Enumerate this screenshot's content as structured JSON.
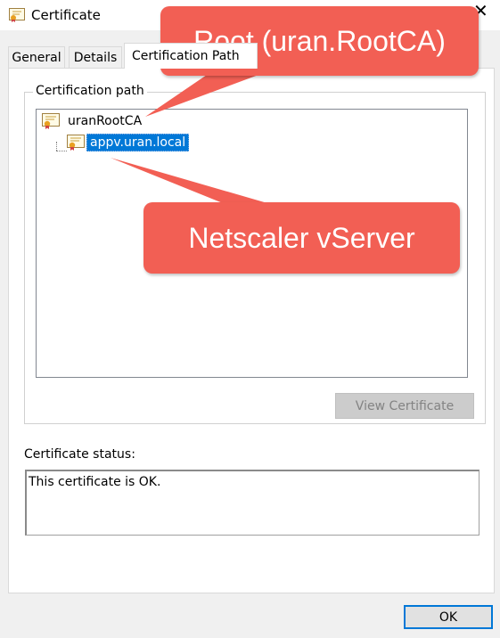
{
  "window": {
    "title": "Certificate",
    "close_glyph": "✕"
  },
  "tabs": [
    {
      "label": "General"
    },
    {
      "label": "Details"
    },
    {
      "label": "Certification Path"
    }
  ],
  "certification_path": {
    "legend": "Certification path",
    "root": {
      "label": "uranRootCA",
      "icon": "certificate-icon"
    },
    "child": {
      "label": "appv.uran.local",
      "icon": "certificate-icon",
      "selected": true
    },
    "view_button": "View Certificate"
  },
  "status": {
    "label": "Certificate status:",
    "text": "This certificate is OK."
  },
  "ok_button": "OK",
  "annotations": {
    "root_callout": "Root (uran.RootCA)",
    "server_callout": "Netscaler vServer",
    "color": "#f25f54"
  },
  "colors": {
    "selection": "#0078d7",
    "default_button_border": "#0078d7"
  }
}
